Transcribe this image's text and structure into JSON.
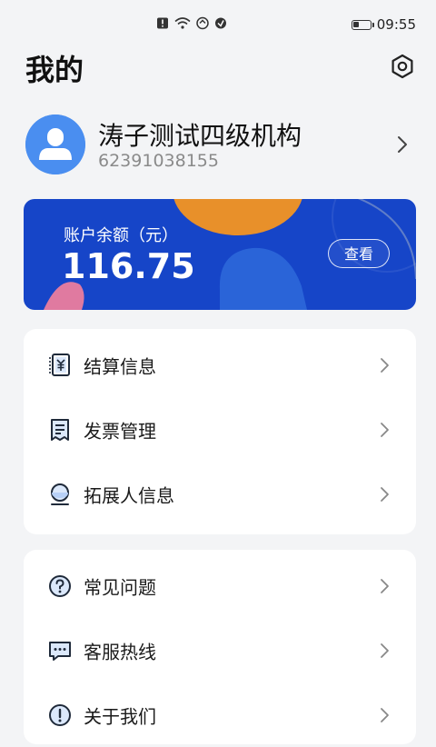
{
  "status_bar": {
    "time": "09:55",
    "icons": [
      "alert-icon",
      "wifi-icon",
      "sync-icon",
      "vpn-icon"
    ],
    "battery_level": 0.35
  },
  "header": {
    "title": "我的",
    "settings_icon": "settings-hexagon-icon"
  },
  "profile": {
    "name": "涛子测试四级机构",
    "id": "62391038155",
    "avatar_icon": "user-avatar-icon"
  },
  "balance": {
    "label": "账户余额（元）",
    "amount": "116.75",
    "view_button": "查看",
    "colors": {
      "card_bg": "#1645c8",
      "orange": "#e8902a",
      "pink": "#e07aa0",
      "blue": "#2a64d8"
    }
  },
  "menu_group_1": [
    {
      "label": "结算信息",
      "icon": "settlement-icon"
    },
    {
      "label": "发票管理",
      "icon": "invoice-icon"
    },
    {
      "label": "拓展人信息",
      "icon": "person-circle-icon"
    }
  ],
  "menu_group_2": [
    {
      "label": "常见问题",
      "icon": "question-icon"
    },
    {
      "label": "客服热线",
      "icon": "chat-icon"
    },
    {
      "label": "关于我们",
      "icon": "info-icon"
    }
  ]
}
